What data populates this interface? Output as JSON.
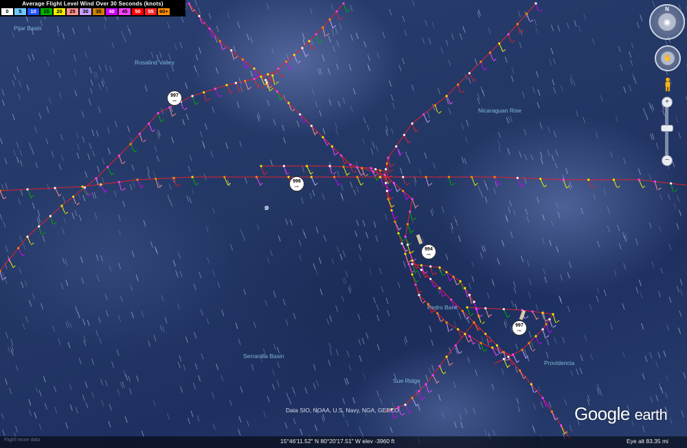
{
  "legend": {
    "title": "Average Flight Level Wind Over 30 Seconds (knots)",
    "entries": [
      {
        "label": "0",
        "color": "#ffffff"
      },
      {
        "label": "5",
        "color": "#6ec8ff"
      },
      {
        "label": "10",
        "color": "#1e50ff"
      },
      {
        "label": "15",
        "color": "#00b000"
      },
      {
        "label": "20",
        "color": "#f0f000"
      },
      {
        "label": "25",
        "color": "#ff9090"
      },
      {
        "label": "30",
        "color": "#c8a0ff"
      },
      {
        "label": "35",
        "color": "#d08000"
      },
      {
        "label": "40",
        "color": "#d000ff"
      },
      {
        "label": "45",
        "color": "#ff40ff"
      },
      {
        "label": "50",
        "color": "#ff0000"
      },
      {
        "label": "55",
        "color": "#ff2020"
      },
      {
        "label": "60+",
        "color": "#ff8c00"
      }
    ]
  },
  "map_labels": [
    "Pijar Basin",
    "Rosalind Valley",
    "Nicaraguan Rise",
    "Serranilla Basin",
    "Sue Ridge",
    "Pedro Bank",
    "Providencia"
  ],
  "pressure_readings": [
    {
      "value": "997",
      "unit": "mb"
    },
    {
      "value": "996",
      "unit": "mb"
    },
    {
      "value": "994",
      "unit": "mb"
    },
    {
      "value": "997",
      "unit": "mb"
    }
  ],
  "data_credit": "Data SIO, NOAA, U.S. Navy, NGA, GEBCO",
  "logo": {
    "google": "Google",
    "earth": "earth"
  },
  "status": {
    "coordinates": "15°46'11.52\" N  80°20'17.51\" W  elev -3960 ft",
    "eye_alt": "Eye alt   83.35 mi",
    "left_hint": "Flight recon data"
  },
  "nav": {
    "north_label": "N",
    "zoom_in": "+",
    "zoom_out": "−"
  },
  "track_colors": {
    "main": "#e8202e",
    "barb": "#e8202e"
  }
}
